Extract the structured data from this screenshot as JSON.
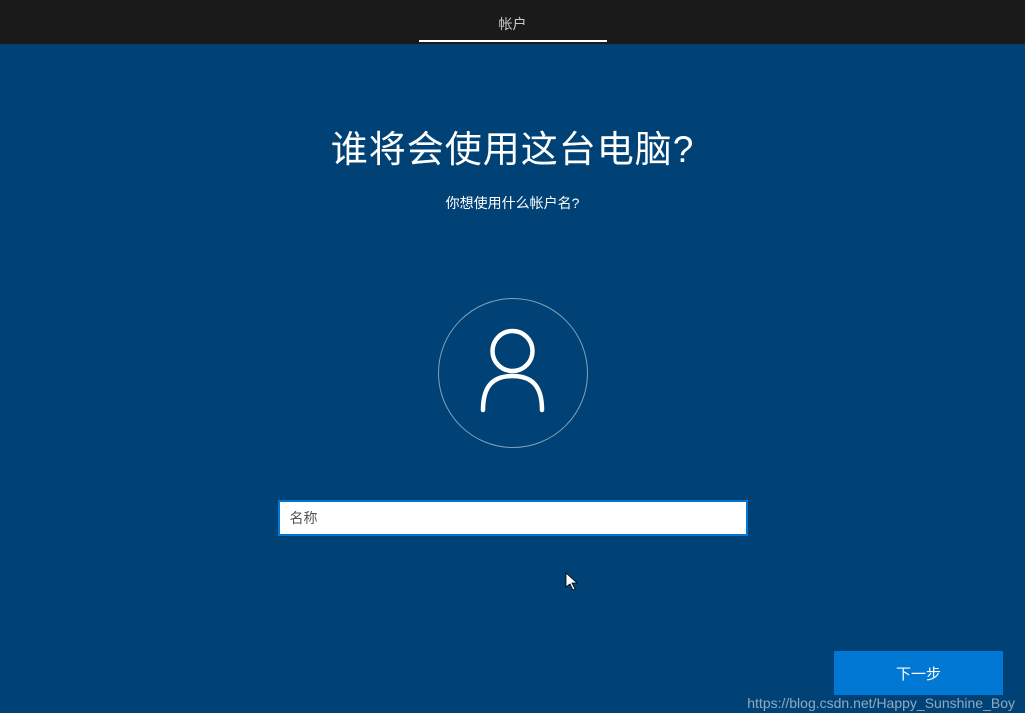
{
  "header": {
    "tab_label": "帐户"
  },
  "main": {
    "title": "谁将会使用这台电脑?",
    "subtitle": "你想使用什么帐户名?",
    "name_placeholder": "名称",
    "name_value": ""
  },
  "footer": {
    "next_label": "下一步"
  },
  "watermark": "https://blog.csdn.net/Happy_Sunshine_Boy",
  "icons": {
    "user": "user-icon"
  },
  "colors": {
    "background": "#004275",
    "header_bg": "#1a1a1a",
    "accent": "#0078d4",
    "text": "#ffffff"
  }
}
